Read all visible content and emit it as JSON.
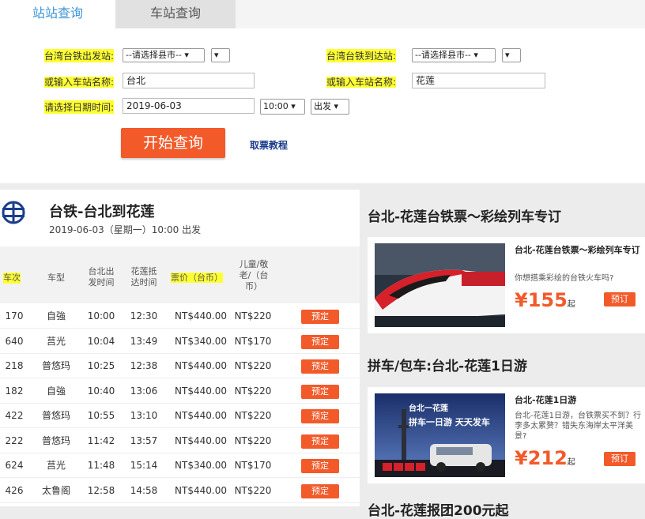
{
  "tabs": [
    "站站查询",
    "车站查询"
  ],
  "form": {
    "depart_label": "台湾台铁出发站:",
    "arrive_label": "台湾台铁到达站:",
    "city_placeholder": "--请选择县市--",
    "station_input_label": "或输入车站名称:",
    "depart_station": "台北",
    "arrive_station": "花莲",
    "date_label": "请选择日期时间:",
    "date_value": "2019-06-03",
    "time_value": "10:00",
    "mode_value": "出发",
    "search_button": "开始查询",
    "guide_link": "取票教程"
  },
  "result": {
    "title": "台铁-台北到花莲",
    "subtitle": "2019-06-03（星期一）10:00 出发",
    "headers": [
      "车次",
      "车型",
      "台北出发时间",
      "花莲抵达时间",
      "票价（台币）",
      "儿童/敬老/（台币）"
    ],
    "book_label": "预定",
    "rows": [
      {
        "no": "170",
        "type": "自強",
        "dep": "10:00",
        "arr": "12:30",
        "price": "NT$440.00",
        "child": "NT$220"
      },
      {
        "no": "640",
        "type": "莒光",
        "dep": "10:04",
        "arr": "13:49",
        "price": "NT$340.00",
        "child": "NT$170"
      },
      {
        "no": "218",
        "type": "普悠玛",
        "dep": "10:25",
        "arr": "12:38",
        "price": "NT$440.00",
        "child": "NT$220"
      },
      {
        "no": "182",
        "type": "自強",
        "dep": "10:40",
        "arr": "13:06",
        "price": "NT$440.00",
        "child": "NT$220"
      },
      {
        "no": "422",
        "type": "普悠玛",
        "dep": "10:55",
        "arr": "13:10",
        "price": "NT$440.00",
        "child": "NT$220"
      },
      {
        "no": "222",
        "type": "普悠玛",
        "dep": "11:42",
        "arr": "13:57",
        "price": "NT$440.00",
        "child": "NT$220"
      },
      {
        "no": "624",
        "type": "莒光",
        "dep": "11:48",
        "arr": "15:14",
        "price": "NT$340.00",
        "child": "NT$170"
      },
      {
        "no": "426",
        "type": "太鲁阁",
        "dep": "12:58",
        "arr": "14:58",
        "price": "NT$440.00",
        "child": "NT$220"
      }
    ]
  },
  "side": {
    "section1": "台北-花莲台铁票～彩绘列车专订",
    "card1": {
      "title": "台北-花莲台铁票～彩绘列车专订",
      "desc": "你想搭乘彩绘的台铁火车吗?",
      "price": "¥155",
      "unit": "起",
      "book": "预订"
    },
    "section2": "拼车/包车:台北-花莲1日游",
    "card2": {
      "title": "台北-花莲1日游",
      "desc": "台北-花莲1日游，台铁票买不到？行李多太累赘？错失东海岸太平洋美景?",
      "price": "¥212",
      "unit": "起",
      "book": "预订",
      "banner1": "台北一花莲",
      "banner2": "拼车一日游  天天发车"
    },
    "section3": "台北-花莲报团200元起"
  },
  "colors": {
    "accent": "#f25a2a",
    "tab_active": "#3b95d6",
    "highlight": "#ffff33"
  }
}
